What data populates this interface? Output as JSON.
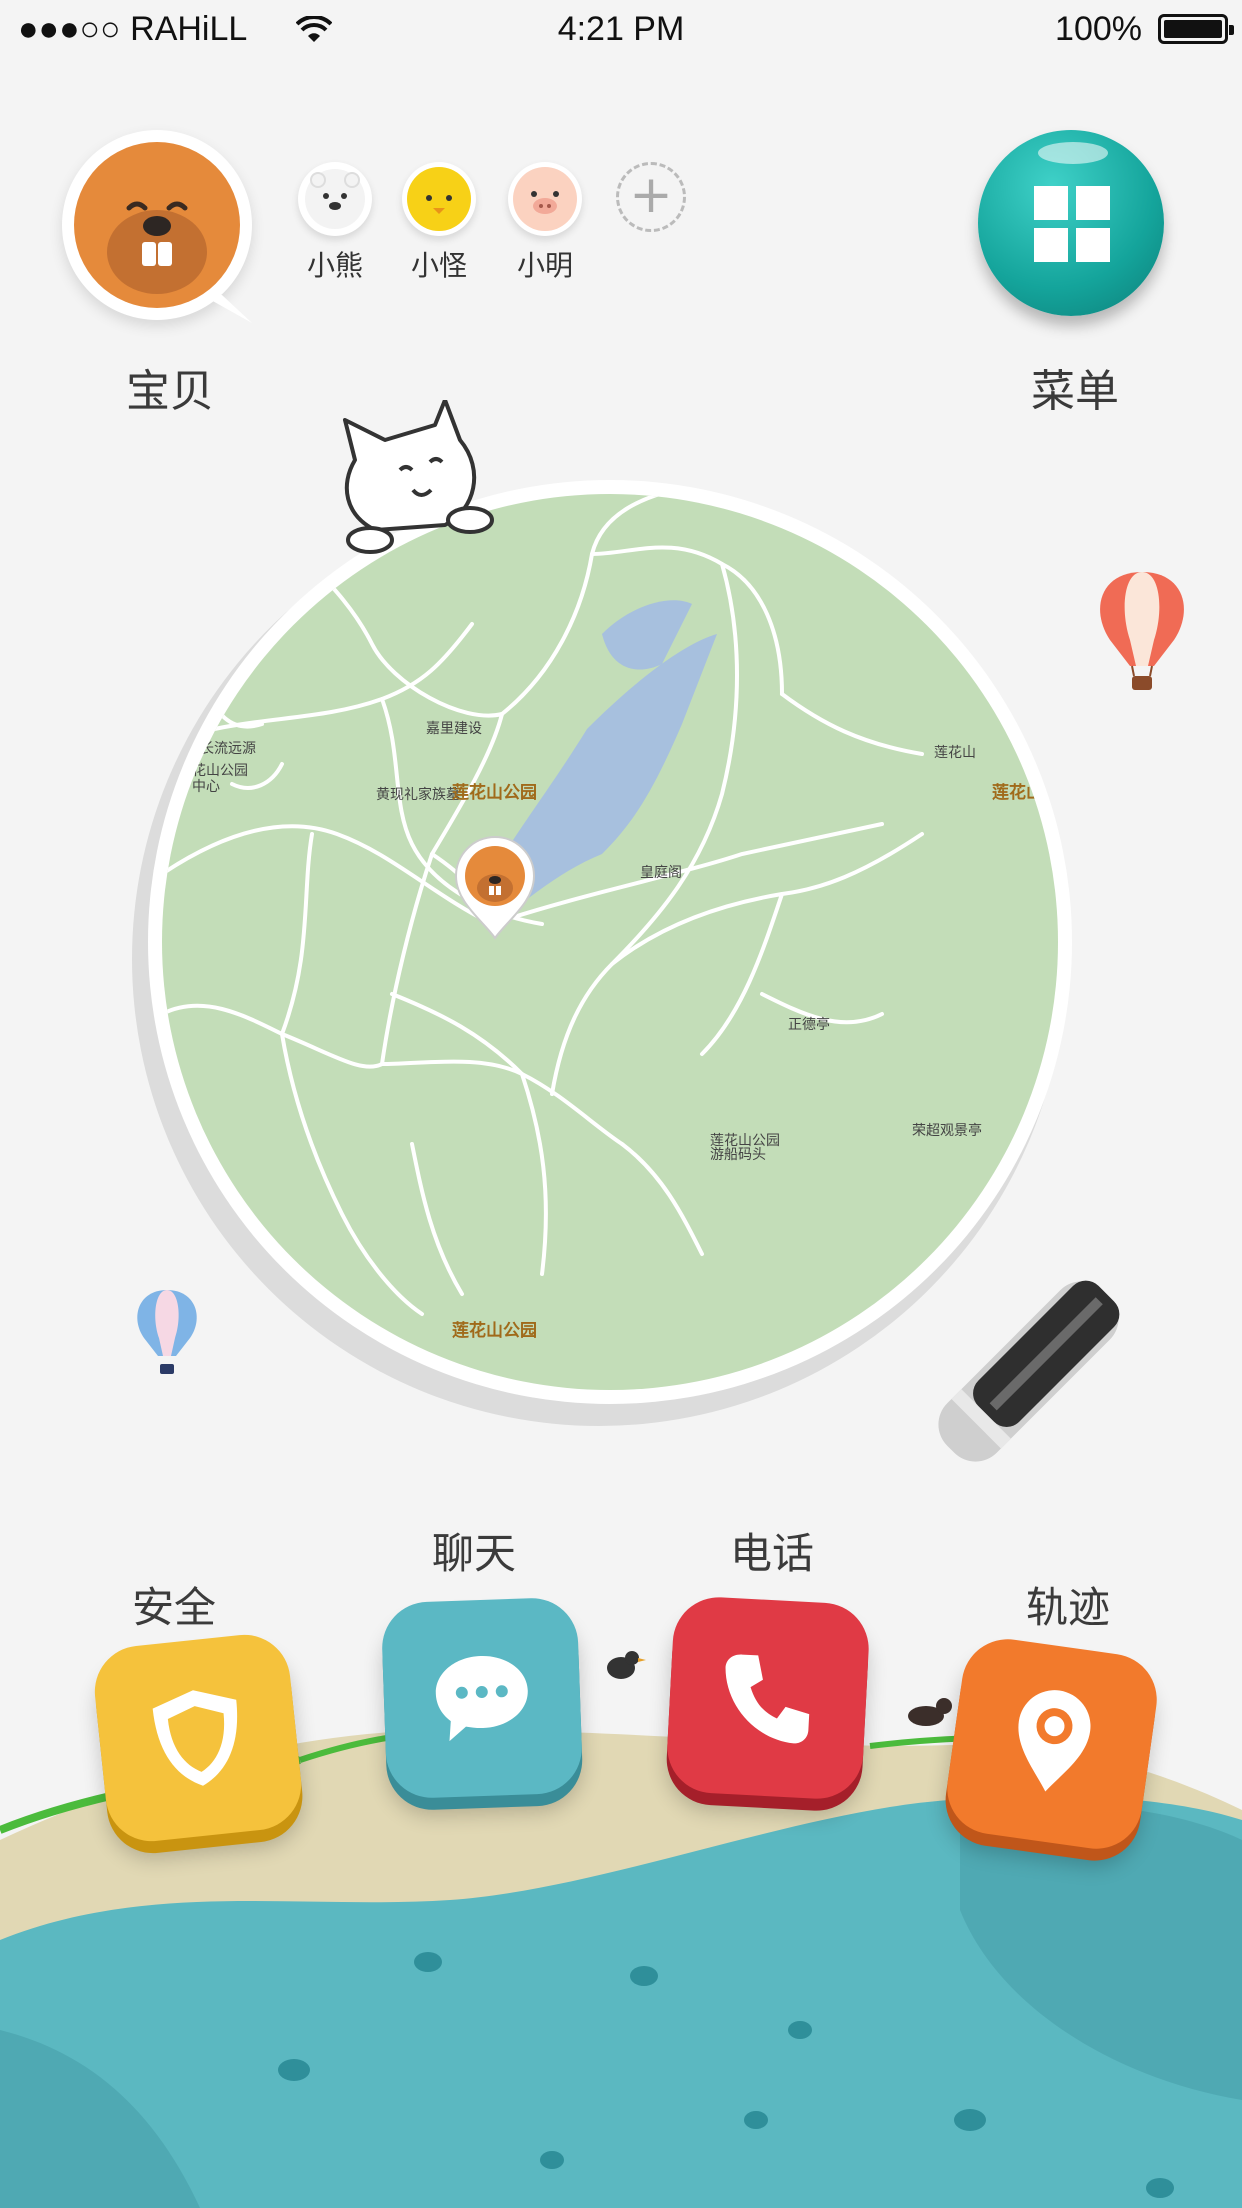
{
  "status_bar": {
    "signal": "●●●○○",
    "carrier": "RAHiLL",
    "time": "4:21 PM",
    "battery": "100%"
  },
  "profile": {
    "main_label": "宝贝",
    "children": [
      {
        "name": "小熊",
        "icon": "polar-bear-avatar"
      },
      {
        "name": "小怪",
        "icon": "chick-avatar"
      },
      {
        "name": "小明",
        "icon": "pig-avatar"
      }
    ],
    "add_symbol": "+"
  },
  "menu": {
    "label": "菜单",
    "icon": "grid-icon"
  },
  "map": {
    "places": [
      {
        "id": "jiali",
        "text": "嘉里建设"
      },
      {
        "id": "changliu",
        "text": "长流远源"
      },
      {
        "id": "lianhuashan_small",
        "text": "花山公园"
      },
      {
        "id": "zhongxin",
        "text": "中心"
      },
      {
        "id": "huangxian",
        "text": "黄现礼家族墓"
      },
      {
        "id": "park1",
        "text": "莲花山公园"
      },
      {
        "id": "huangting",
        "text": "皇庭阁"
      },
      {
        "id": "lianhuashan",
        "text": "莲花山"
      },
      {
        "id": "park_right",
        "text": "莲花山"
      },
      {
        "id": "zhengde",
        "text": "正德亭"
      },
      {
        "id": "rongchao",
        "text": "荣超观景亭"
      },
      {
        "id": "matou1",
        "text": "莲花山公园"
      },
      {
        "id": "matou2",
        "text": "游船码头"
      },
      {
        "id": "park2",
        "text": "莲花山公园"
      }
    ]
  },
  "actions": [
    {
      "label": "安全",
      "icon": "shield-icon",
      "color": "#f5c23c"
    },
    {
      "label": "聊天",
      "icon": "chat-bubble-icon",
      "color": "#5bb8c4"
    },
    {
      "label": "电话",
      "icon": "phone-icon",
      "color": "#e03a45"
    },
    {
      "label": "轨迹",
      "icon": "location-pin-icon",
      "color": "#f27a2c"
    }
  ],
  "colors": {
    "background": "#f4f4f4",
    "map_green": "#c3ddb8",
    "water": "#a7c0de",
    "sea": "#5bb8c1",
    "sand": "#e1d8b4",
    "grass": "#4bbb3c"
  }
}
